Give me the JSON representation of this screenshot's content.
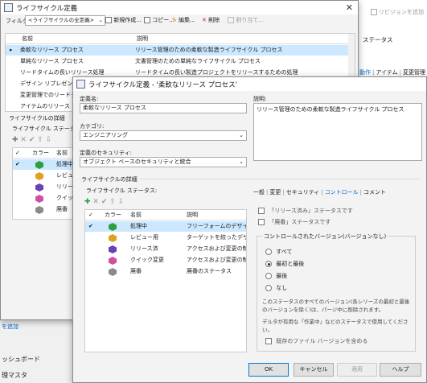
{
  "right_bg": {
    "revision_button": "リビジョンを追加",
    "status_header": "ステータス",
    "tabs": [
      "動作",
      "アイテム",
      "変更管理"
    ]
  },
  "left_bg": {
    "add_link": "を追加",
    "nav_items": [
      "ッシュボード",
      "理マスタ"
    ]
  },
  "main_window": {
    "title": "ライフサイクル定義",
    "filter_label": "フィルタ:",
    "filter_value": "<ライフサイクルの全定義>",
    "toolbar": {
      "new": "新規作成...",
      "copy": "コピー...",
      "edit": "編集...",
      "delete": "削除",
      "assign": "割り当て..."
    },
    "columns": [
      "名前",
      "説明"
    ],
    "rows": [
      {
        "name": "柔軟なリリース プロセス",
        "desc": "リリース管理のための柔軟な製造ライフサイクル プロセス",
        "selected": true
      },
      {
        "name": "単純なリリース プロセス",
        "desc": "文書管理のための単純なライフサイクル プロセス"
      },
      {
        "name": "リードタイムの長いリリース処理",
        "desc": "リードタイムの長い製造プロジェクトをリリースするための処理"
      },
      {
        "name": "デザイン リプレゼンテーシ",
        "desc": ""
      },
      {
        "name": "変更管理でのリードタイ",
        "desc": ""
      },
      {
        "name": "アイテムのリリース プロセ",
        "desc": ""
      }
    ],
    "details_label": "ライフサイクルの詳細",
    "statuses_label": "ライフサイクル ステータス:",
    "status_columns": [
      "カラー",
      "名前"
    ],
    "statuses": [
      "処理中",
      "レビュー用",
      "リリース済",
      "クイック変更",
      "廃番"
    ]
  },
  "dialog": {
    "title": "ライフサイクル定義 - '柔軟なリリース プロセス'",
    "name_label": "定義名:",
    "name_value": "柔軟なリリース プロセス",
    "desc_label": "説明:",
    "desc_value": "リリース管理のための柔軟な製造ライフサイクル プロセス",
    "category_label": "カテゴリ:",
    "category_value": "エンジニアリング",
    "security_label": "定義のセキュリティ:",
    "security_value": "オブジェクト ベースのセキュリティと統合",
    "details_label": "ライフサイクルの詳細",
    "statuses_label": "ライフサイクル ステータス:",
    "columns": [
      "カラー",
      "名前",
      "説明"
    ],
    "statuses": [
      {
        "name": "処理中",
        "desc": "フリーフォームのデザイン作...",
        "color": "#2e9e3e",
        "selected": true
      },
      {
        "name": "レビュー用",
        "desc": "ターゲットを絞ったデザイン...",
        "color": "#e0a020"
      },
      {
        "name": "リリース済",
        "desc": "アクセスおよび変更の制...",
        "color": "#6a3fb8"
      },
      {
        "name": "クイック変更",
        "desc": "アクセスおよび変更の制...",
        "color": "#d04fa0"
      },
      {
        "name": "廃番",
        "desc": "廃番のステータス",
        "color": "#8a8a8a"
      }
    ],
    "tabs": [
      "一般",
      "変更",
      "セキュリティ",
      "コントロール",
      "コメント"
    ],
    "active_tab": "コントロール",
    "chk_released": "「リリース済み」ステータスです",
    "chk_obsolete": "「廃番」ステータスです",
    "group_title": "コントロールされたバージョン(バージョンなし)",
    "radios": [
      "すべて",
      "最初と最後",
      "最後",
      "なし"
    ],
    "radio_selected": 1,
    "info1": "このステータスのすべてのバージョン(各シリーズの最初と最後のバージョンを除く)は、パージ中に削除されます。",
    "info2": "デルタが有用な「作業中」などのステータスで使用してください。",
    "chk_existing": "既存のファイル バージョンを含める",
    "buttons": {
      "ok": "OK",
      "cancel": "キャンセル",
      "apply": "適用",
      "help": "ヘルプ"
    }
  }
}
